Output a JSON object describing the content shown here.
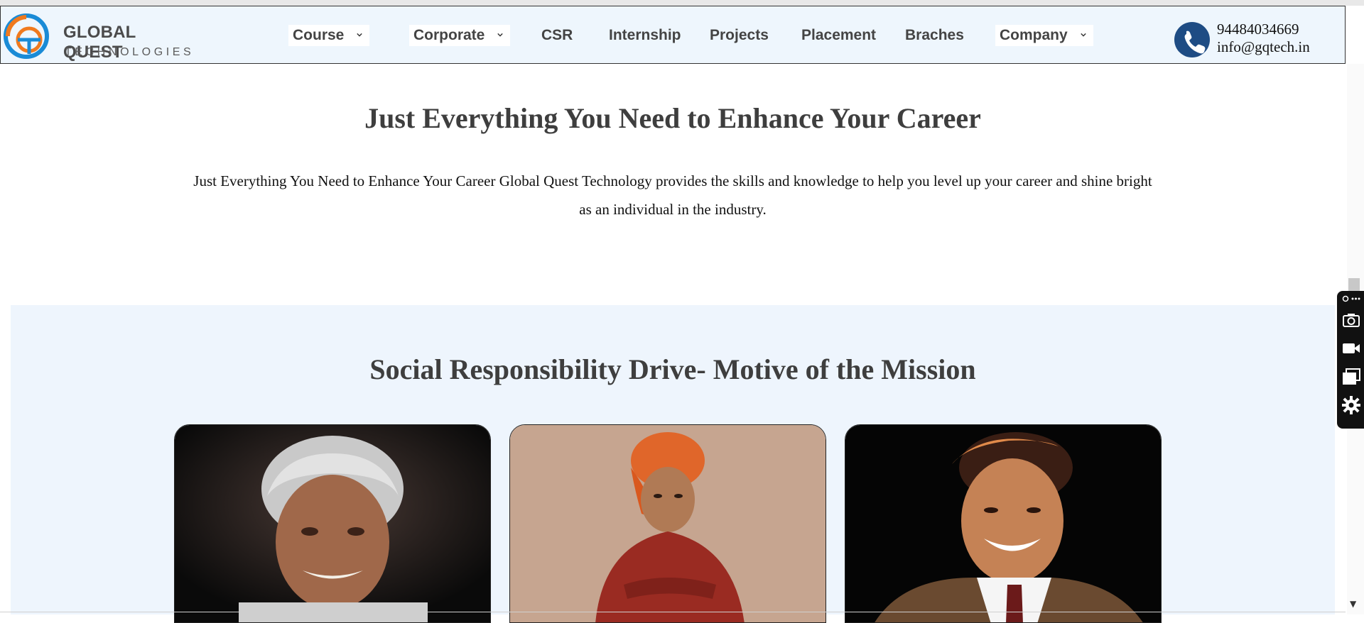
{
  "brand": {
    "name_line1": "GLOBAL QUEST",
    "name_line2": "TECHNOLOGIES"
  },
  "nav": {
    "items": [
      {
        "label": "Course",
        "dropdown": true
      },
      {
        "label": "Corporate",
        "dropdown": true
      },
      {
        "label": "CSR",
        "dropdown": false
      },
      {
        "label": "Internship",
        "dropdown": false
      },
      {
        "label": "Projects",
        "dropdown": false
      },
      {
        "label": "Placement",
        "dropdown": false
      },
      {
        "label": "Braches",
        "dropdown": false
      },
      {
        "label": "Company",
        "dropdown": true
      }
    ],
    "phone": "94484034669",
    "email": "info@gqtech.in",
    "phone_icon": "phone-icon"
  },
  "hero": {
    "title": "Just Everything You Need to Enhance Your Career",
    "text": "Just Everything You Need to Enhance Your Career Global Quest Technology provides the skills and knowledge to help you level up your career and shine bright as an individual in the industry."
  },
  "csr": {
    "title": "Social Responsibility Drive- Motive of the Mission",
    "cards": [
      {
        "image": "portrait-elderly-man-silver-hair"
      },
      {
        "image": "portrait-man-orange-turban"
      },
      {
        "image": "portrait-smiling-man-suit"
      }
    ]
  },
  "toolbar": {
    "icons": [
      "link-icon",
      "more-icon",
      "camera-icon",
      "video-icon",
      "window-icon",
      "gear-icon"
    ]
  },
  "colors": {
    "nav_bg": "#eef6fd",
    "section_bg": "#eef5fd",
    "accent_blue": "#1e4c84",
    "logo_orange": "#f07a1e",
    "logo_blue": "#1a8bd6"
  }
}
